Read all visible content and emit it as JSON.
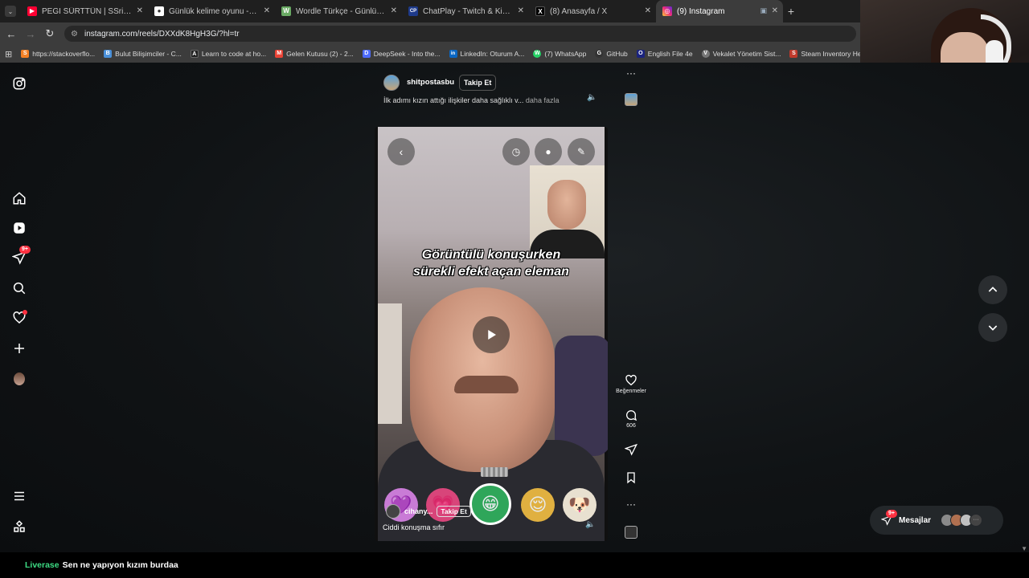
{
  "tabs": [
    {
      "title": "PEGİ SÜRTTÜN | SSriders | Mot...",
      "favicon_color": "#ff0033",
      "favicon_char": "▶"
    },
    {
      "title": "Günlük kelime oyunu - parolla",
      "favicon_color": "#ffffff",
      "favicon_char": "●"
    },
    {
      "title": "Wordle Türkçe - Günlük Kelime...",
      "favicon_color": "#6aaa64",
      "favicon_char": "W"
    },
    {
      "title": "ChatPlay - Twitch & Kick İzleyici...",
      "favicon_color": "#1e3a8a",
      "favicon_char": "CP"
    },
    {
      "title": "(8) Anasayfa / X",
      "favicon_color": "#000000",
      "favicon_char": "X"
    },
    {
      "title": "(9) Instagram",
      "favicon_color": "#d62976",
      "favicon_char": "◎",
      "active": true
    }
  ],
  "address": {
    "url": "instagram.com/reels/DXXdK8HgH3G/?hl=tr"
  },
  "bookmarks": [
    {
      "label": "https://stackoverflo...",
      "color": "#f48024",
      "char": "S"
    },
    {
      "label": "Bulut Bilişimciler - C...",
      "color": "#4a90d9",
      "char": "B"
    },
    {
      "label": "Learn to code at ho...",
      "color": "#222222",
      "char": "A"
    },
    {
      "label": "Gelen Kutusu (2) - 2...",
      "color": "#ea4335",
      "char": "M"
    },
    {
      "label": "DeepSeek - Into the...",
      "color": "#4d6bfe",
      "char": "D"
    },
    {
      "label": "LinkedIn: Oturum A...",
      "color": "#0a66c2",
      "char": "in"
    },
    {
      "label": "(7) WhatsApp",
      "color": "#25d366",
      "char": "W"
    },
    {
      "label": "GitHub",
      "color": "#333333",
      "char": "G"
    },
    {
      "label": "English File 4e",
      "color": "#1a237e",
      "char": "O"
    },
    {
      "label": "Vekalet Yönetim Sist...",
      "color": "#777777",
      "char": "V"
    },
    {
      "label": "Steam Inventory Hel...",
      "color": "#c0392b",
      "char": "S"
    }
  ],
  "sidebar": {
    "notification_badge": "9+"
  },
  "reel": {
    "username": "shitpostasbu",
    "follow_label": "Takip Et",
    "caption": "İlk adımı kızın attığı ilişkiler daha sağlıklı v...",
    "more_label": "daha fazla",
    "video_caption_line1": "Görüntülü konuşurken",
    "video_caption_line2": "sürekli efekt açan eleman",
    "video_username": "cihany...",
    "video_follow_label": "Takip Et",
    "video_caption": "Ciddi konuşma sıfır"
  },
  "actions": {
    "likes_label": "Beğenmeler",
    "comments_count": "606"
  },
  "messages": {
    "label": "Mesajlar",
    "badge": "9+"
  },
  "stream_chat": {
    "user": "Liverase",
    "message": "Sen ne yapıyon kızım burdaa"
  }
}
